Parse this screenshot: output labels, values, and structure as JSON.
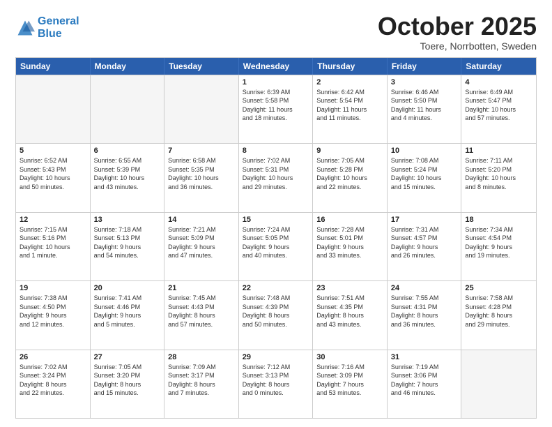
{
  "header": {
    "logo_line1": "General",
    "logo_line2": "Blue",
    "month": "October 2025",
    "location": "Toere, Norrbotten, Sweden"
  },
  "weekdays": [
    "Sunday",
    "Monday",
    "Tuesday",
    "Wednesday",
    "Thursday",
    "Friday",
    "Saturday"
  ],
  "rows": [
    [
      {
        "day": "",
        "text": "",
        "empty": true
      },
      {
        "day": "",
        "text": "",
        "empty": true
      },
      {
        "day": "",
        "text": "",
        "empty": true
      },
      {
        "day": "1",
        "text": "Sunrise: 6:39 AM\nSunset: 5:58 PM\nDaylight: 11 hours\nand 18 minutes."
      },
      {
        "day": "2",
        "text": "Sunrise: 6:42 AM\nSunset: 5:54 PM\nDaylight: 11 hours\nand 11 minutes."
      },
      {
        "day": "3",
        "text": "Sunrise: 6:46 AM\nSunset: 5:50 PM\nDaylight: 11 hours\nand 4 minutes."
      },
      {
        "day": "4",
        "text": "Sunrise: 6:49 AM\nSunset: 5:47 PM\nDaylight: 10 hours\nand 57 minutes."
      }
    ],
    [
      {
        "day": "5",
        "text": "Sunrise: 6:52 AM\nSunset: 5:43 PM\nDaylight: 10 hours\nand 50 minutes."
      },
      {
        "day": "6",
        "text": "Sunrise: 6:55 AM\nSunset: 5:39 PM\nDaylight: 10 hours\nand 43 minutes."
      },
      {
        "day": "7",
        "text": "Sunrise: 6:58 AM\nSunset: 5:35 PM\nDaylight: 10 hours\nand 36 minutes."
      },
      {
        "day": "8",
        "text": "Sunrise: 7:02 AM\nSunset: 5:31 PM\nDaylight: 10 hours\nand 29 minutes."
      },
      {
        "day": "9",
        "text": "Sunrise: 7:05 AM\nSunset: 5:28 PM\nDaylight: 10 hours\nand 22 minutes."
      },
      {
        "day": "10",
        "text": "Sunrise: 7:08 AM\nSunset: 5:24 PM\nDaylight: 10 hours\nand 15 minutes."
      },
      {
        "day": "11",
        "text": "Sunrise: 7:11 AM\nSunset: 5:20 PM\nDaylight: 10 hours\nand 8 minutes."
      }
    ],
    [
      {
        "day": "12",
        "text": "Sunrise: 7:15 AM\nSunset: 5:16 PM\nDaylight: 10 hours\nand 1 minute."
      },
      {
        "day": "13",
        "text": "Sunrise: 7:18 AM\nSunset: 5:13 PM\nDaylight: 9 hours\nand 54 minutes."
      },
      {
        "day": "14",
        "text": "Sunrise: 7:21 AM\nSunset: 5:09 PM\nDaylight: 9 hours\nand 47 minutes."
      },
      {
        "day": "15",
        "text": "Sunrise: 7:24 AM\nSunset: 5:05 PM\nDaylight: 9 hours\nand 40 minutes."
      },
      {
        "day": "16",
        "text": "Sunrise: 7:28 AM\nSunset: 5:01 PM\nDaylight: 9 hours\nand 33 minutes."
      },
      {
        "day": "17",
        "text": "Sunrise: 7:31 AM\nSunset: 4:57 PM\nDaylight: 9 hours\nand 26 minutes."
      },
      {
        "day": "18",
        "text": "Sunrise: 7:34 AM\nSunset: 4:54 PM\nDaylight: 9 hours\nand 19 minutes."
      }
    ],
    [
      {
        "day": "19",
        "text": "Sunrise: 7:38 AM\nSunset: 4:50 PM\nDaylight: 9 hours\nand 12 minutes."
      },
      {
        "day": "20",
        "text": "Sunrise: 7:41 AM\nSunset: 4:46 PM\nDaylight: 9 hours\nand 5 minutes."
      },
      {
        "day": "21",
        "text": "Sunrise: 7:45 AM\nSunset: 4:43 PM\nDaylight: 8 hours\nand 57 minutes."
      },
      {
        "day": "22",
        "text": "Sunrise: 7:48 AM\nSunset: 4:39 PM\nDaylight: 8 hours\nand 50 minutes."
      },
      {
        "day": "23",
        "text": "Sunrise: 7:51 AM\nSunset: 4:35 PM\nDaylight: 8 hours\nand 43 minutes."
      },
      {
        "day": "24",
        "text": "Sunrise: 7:55 AM\nSunset: 4:31 PM\nDaylight: 8 hours\nand 36 minutes."
      },
      {
        "day": "25",
        "text": "Sunrise: 7:58 AM\nSunset: 4:28 PM\nDaylight: 8 hours\nand 29 minutes."
      }
    ],
    [
      {
        "day": "26",
        "text": "Sunrise: 7:02 AM\nSunset: 3:24 PM\nDaylight: 8 hours\nand 22 minutes."
      },
      {
        "day": "27",
        "text": "Sunrise: 7:05 AM\nSunset: 3:20 PM\nDaylight: 8 hours\nand 15 minutes."
      },
      {
        "day": "28",
        "text": "Sunrise: 7:09 AM\nSunset: 3:17 PM\nDaylight: 8 hours\nand 7 minutes."
      },
      {
        "day": "29",
        "text": "Sunrise: 7:12 AM\nSunset: 3:13 PM\nDaylight: 8 hours\nand 0 minutes."
      },
      {
        "day": "30",
        "text": "Sunrise: 7:16 AM\nSunset: 3:09 PM\nDaylight: 7 hours\nand 53 minutes."
      },
      {
        "day": "31",
        "text": "Sunrise: 7:19 AM\nSunset: 3:06 PM\nDaylight: 7 hours\nand 46 minutes."
      },
      {
        "day": "",
        "text": "",
        "empty": true
      }
    ]
  ]
}
